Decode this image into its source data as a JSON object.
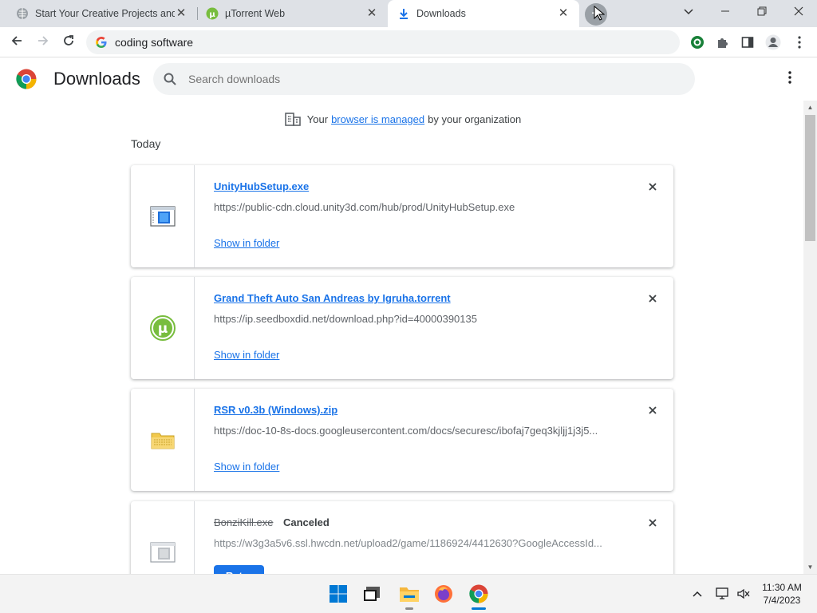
{
  "tabs": [
    {
      "title": "Start Your Creative Projects and D",
      "icon": "puzzle-globe-icon"
    },
    {
      "title": "µTorrent Web",
      "icon": "utorrent-icon"
    },
    {
      "title": "Downloads",
      "icon": "download-arrow-icon"
    }
  ],
  "newtab_label": "+",
  "window_controls": {
    "minimize": "—",
    "restore": "❐",
    "close": "✕",
    "tabsearch": "⌄"
  },
  "omnibox": {
    "text": "coding software"
  },
  "page": {
    "title": "Downloads",
    "search_placeholder": "Search downloads",
    "managed_prefix": "Your",
    "managed_link": "browser is managed",
    "managed_suffix": "by your organization",
    "section_label": "Today"
  },
  "downloads": [
    {
      "name": "UnityHubSetup.exe",
      "url": "https://public-cdn.cloud.unity3d.com/hub/prod/UnityHubSetup.exe",
      "action": "Show in folder",
      "icon": "exe-file-icon"
    },
    {
      "name": "Grand Theft Auto San Andreas by Igruha.torrent",
      "url": "https://ip.seedboxdid.net/download.php?id=40000390135",
      "action": "Show in folder",
      "icon": "utorrent-file-icon"
    },
    {
      "name": "RSR v0.3b (Windows).zip",
      "url": "https://doc-10-8s-docs.googleusercontent.com/docs/securesc/ibofaj7geq3kjljj1j3j5...",
      "action": "Show in folder",
      "icon": "zip-folder-icon"
    },
    {
      "name": "BonziKill.exe",
      "status": "Canceled",
      "url": "https://w3g3a5v6.ssl.hwcdn.net/upload2/game/1186924/4412630?GoogleAccessId...",
      "action": "Retry",
      "icon": "exe-file-icon"
    }
  ],
  "taskbar": {
    "time": "11:30 AM",
    "date": "7/4/2023"
  },
  "colors": {
    "accent": "#1a73e8",
    "tabstrip": "#dee1e6",
    "taskbar": "#f3f3f3"
  }
}
